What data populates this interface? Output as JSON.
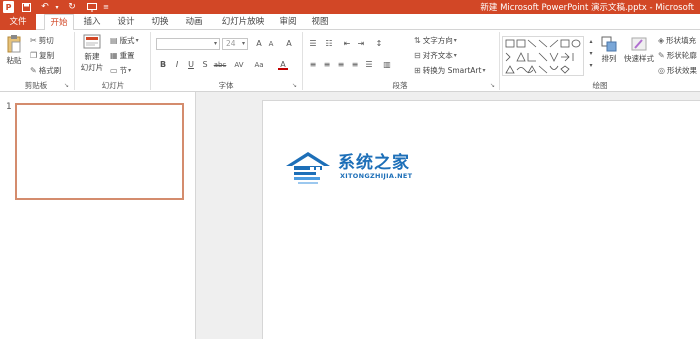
{
  "titlebar": {
    "app_logo": "P",
    "qa_items": [
      "save-icon",
      "undo-icon",
      "redo-icon",
      "start-from-beginning-icon",
      "customize-qat-icon"
    ],
    "doc_title": "新建 Microsoft PowerPoint 演示文稿.pptx - Microsoft"
  },
  "tabs": [
    {
      "label": "文件",
      "kind": "file"
    },
    {
      "label": "开始",
      "kind": "active"
    },
    {
      "label": "插入",
      "kind": "normal"
    },
    {
      "label": "设计",
      "kind": "normal"
    },
    {
      "label": "切换",
      "kind": "normal"
    },
    {
      "label": "动画",
      "kind": "normal"
    },
    {
      "label": "幻灯片放映",
      "kind": "normal"
    },
    {
      "label": "审阅",
      "kind": "normal"
    },
    {
      "label": "视图",
      "kind": "normal"
    }
  ],
  "ribbon": {
    "clipboard": {
      "paste": "粘贴",
      "cut": "剪切",
      "copy": "复制",
      "format_painter": "格式刷",
      "label": "剪贴板"
    },
    "slides": {
      "new_slide_line1": "新建",
      "new_slide_line2": "幻灯片",
      "layout": "版式",
      "reset": "重置",
      "section": "节",
      "label": "幻灯片"
    },
    "font": {
      "font_name": "",
      "font_size": "24",
      "grow": "A",
      "shrink": "A",
      "clear": "A",
      "bold": "B",
      "italic": "I",
      "underline": "U",
      "shadow": "S",
      "strike": "abc",
      "spacing": "AV",
      "case": "Aa",
      "color": "A",
      "label": "字体"
    },
    "paragraph": {
      "text_direction": "文字方向",
      "align_text": "对齐文本",
      "smartart": "转换为 SmartArt",
      "label": "段落"
    },
    "drawing": {
      "arrange": "排列",
      "quick_styles": "快速样式",
      "shape_fill": "形状填充",
      "shape_outline": "形状轮廓",
      "shape_effects": "形状效果",
      "label": "绘图"
    }
  },
  "thumbnails": {
    "slide_number": "1"
  },
  "watermark": {
    "title": "系统之家",
    "url": "XITONGZHIJIA.NET"
  },
  "colors": {
    "accent": "#d24726",
    "watermark": "#1d6fb8"
  }
}
